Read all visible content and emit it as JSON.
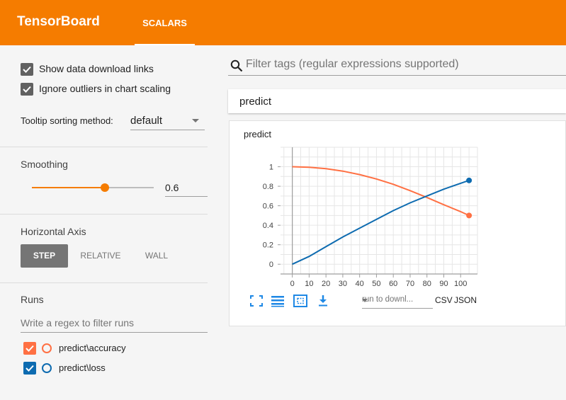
{
  "app": {
    "title": "TensorBoard"
  },
  "tabs": [
    {
      "label": "SCALARS"
    }
  ],
  "sidebar": {
    "show_download_links": {
      "label": "Show data download links",
      "checked": true
    },
    "ignore_outliers": {
      "label": "Ignore outliers in chart scaling",
      "checked": true
    },
    "tooltip_sorting": {
      "label": "Tooltip sorting method:",
      "value": "default"
    },
    "smoothing": {
      "label": "Smoothing",
      "value": "0.6",
      "fraction": 0.6
    },
    "horizontal_axis": {
      "label": "Horizontal Axis",
      "options": [
        "STEP",
        "RELATIVE",
        "WALL"
      ],
      "selected": "STEP"
    },
    "runs": {
      "label": "Runs",
      "filter_placeholder": "Write a regex to filter runs",
      "items": [
        {
          "name": "predict\\accuracy",
          "checked": true,
          "color": "#ff7043"
        },
        {
          "name": "predict\\loss",
          "checked": true,
          "color": "#0d6bb0"
        }
      ]
    }
  },
  "main": {
    "filter_placeholder": "Filter tags (regular expressions supported)",
    "group_name": "predict",
    "card": {
      "title": "predict",
      "run_select_placeholder": "run to downl...",
      "csv_label": "CSV",
      "json_label": "JSON",
      "tools": [
        "fit-domain-icon",
        "log-scale-icon",
        "zoom-icon",
        "download-icon"
      ]
    }
  },
  "colors": {
    "accent": "#f57c00",
    "accuracy": "#ff7043",
    "loss": "#0d6bb0"
  },
  "chart_data": {
    "type": "line",
    "title": "predict",
    "xlabel": "",
    "ylabel": "",
    "xlim": [
      -7,
      110
    ],
    "ylim": [
      -0.1,
      1.2
    ],
    "x_ticks": [
      0,
      10,
      20,
      30,
      40,
      50,
      60,
      70,
      80,
      90,
      100
    ],
    "y_ticks": [
      0,
      0.2,
      0.4,
      0.6,
      0.8,
      1
    ],
    "y_tick_labels": [
      "0",
      "0.2",
      "0.4",
      "0.6",
      "0.8",
      "1"
    ],
    "grid": true,
    "series": [
      {
        "color": "#ff7043",
        "x": [
          0,
          10,
          20,
          30,
          40,
          50,
          60,
          70,
          80,
          90,
          100,
          105
        ],
        "y": [
          1.0,
          0.995,
          0.98,
          0.955,
          0.92,
          0.875,
          0.82,
          0.755,
          0.685,
          0.61,
          0.54,
          0.5
        ]
      },
      {
        "color": "#0d6bb0",
        "x": [
          0,
          10,
          20,
          30,
          40,
          50,
          60,
          70,
          80,
          90,
          100,
          105
        ],
        "y": [
          0.0,
          0.08,
          0.18,
          0.28,
          0.37,
          0.46,
          0.55,
          0.63,
          0.7,
          0.77,
          0.83,
          0.86
        ]
      }
    ]
  }
}
